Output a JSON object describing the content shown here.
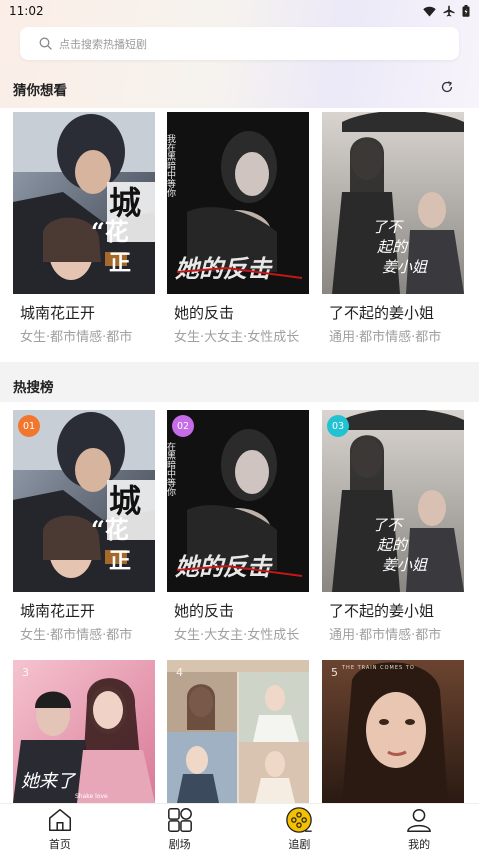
{
  "status": {
    "time": "11:02",
    "icons": [
      "wifi-icon",
      "airplane-icon",
      "battery-icon"
    ]
  },
  "search": {
    "placeholder": "点击搜索热播短剧",
    "icon": "search-icon"
  },
  "guess": {
    "title": "猜你想看",
    "refresh_icon": "refresh-icon",
    "items": [
      {
        "title": "城南花正开",
        "tags": "女生·都市情感·都市"
      },
      {
        "title": "她的反击",
        "tags": "女生·大女主·女性成长"
      },
      {
        "title": "了不起的姜小姐",
        "tags": "通用·都市情感·都市"
      }
    ]
  },
  "hot": {
    "title": "热搜榜",
    "items": [
      {
        "rank": "01",
        "title": "城南花正开",
        "tags": "女生·都市情感·都市"
      },
      {
        "rank": "02",
        "title": "她的反击",
        "tags": "女生·大女主·女性成长"
      },
      {
        "rank": "03",
        "title": "了不起的姜小姐",
        "tags": "通用·都市情感·都市"
      }
    ],
    "more": [
      {
        "rank": "3"
      },
      {
        "rank": "4"
      },
      {
        "rank": "5"
      }
    ]
  },
  "posters": {
    "p1_overlay": "城“花正开",
    "p2_side": "我在黑暗中等你",
    "p2_title": "她的反击",
    "p3_title": "了不起的姜小姐",
    "p4_title": "她来了",
    "p4_sub": "Shake love",
    "p6_top": "THE TRAIN COMES TO"
  },
  "nav": [
    {
      "label": "首页",
      "icon": "home-icon"
    },
    {
      "label": "剧场",
      "icon": "theater-icon"
    },
    {
      "label": "追剧",
      "icon": "follow-drama-icon"
    },
    {
      "label": "我的",
      "icon": "profile-icon"
    }
  ],
  "colors": {
    "rank1": "#f2762e",
    "rank2": "#c66ce8",
    "rank3": "#21c3d3",
    "nav_active": "#f5c000"
  }
}
